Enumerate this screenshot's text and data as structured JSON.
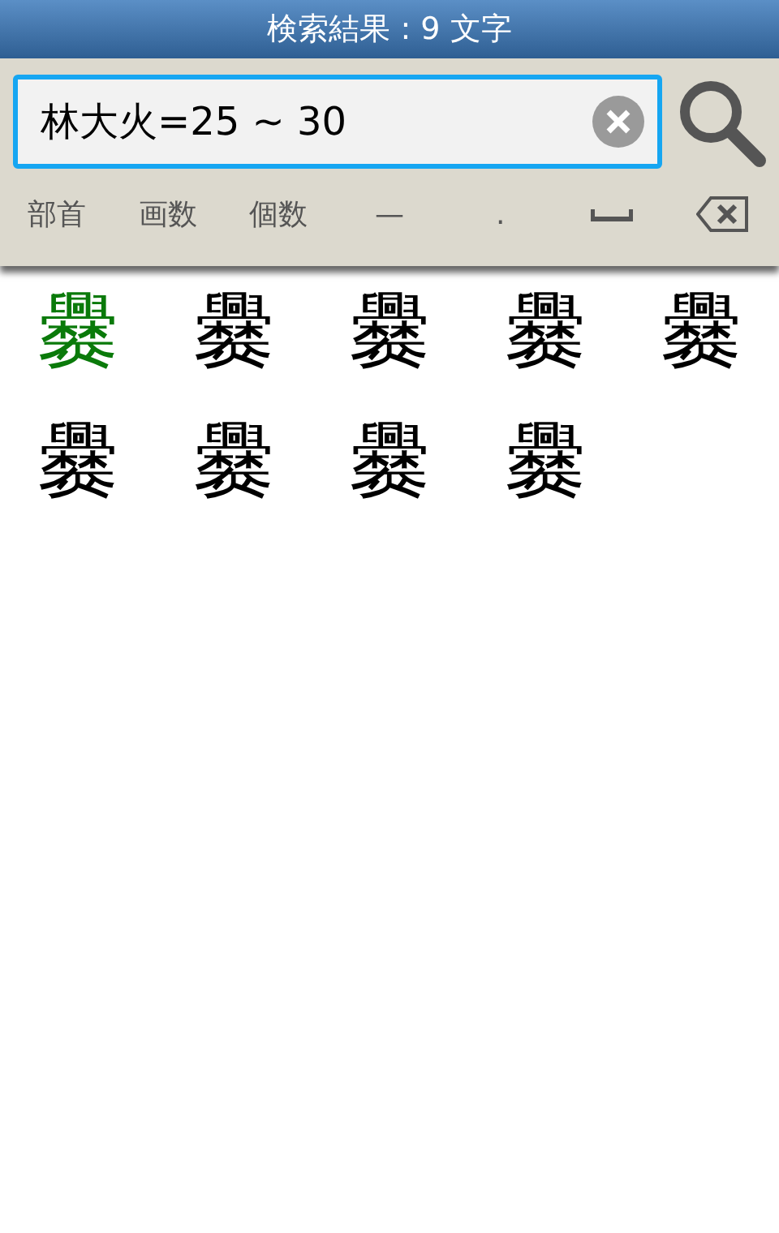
{
  "title": "検索結果 : 9 文字",
  "search": {
    "value": "林大火=25 ~ 30"
  },
  "keys": [
    {
      "kind": "text",
      "label": "部首"
    },
    {
      "kind": "text",
      "label": "画数"
    },
    {
      "kind": "text",
      "label": "個数"
    },
    {
      "kind": "text",
      "label": "—"
    },
    {
      "kind": "text",
      "label": "."
    },
    {
      "kind": "space"
    },
    {
      "kind": "backspace"
    }
  ],
  "results": [
    {
      "char": "爨",
      "selected": true
    },
    {
      "char": "爨",
      "selected": false
    },
    {
      "char": "爨",
      "selected": false
    },
    {
      "char": "爨",
      "selected": false
    },
    {
      "char": "爨",
      "selected": false
    },
    {
      "char": "爨",
      "selected": false
    },
    {
      "char": "爨",
      "selected": false
    },
    {
      "char": "爨",
      "selected": false
    },
    {
      "char": "爨",
      "selected": false
    }
  ]
}
